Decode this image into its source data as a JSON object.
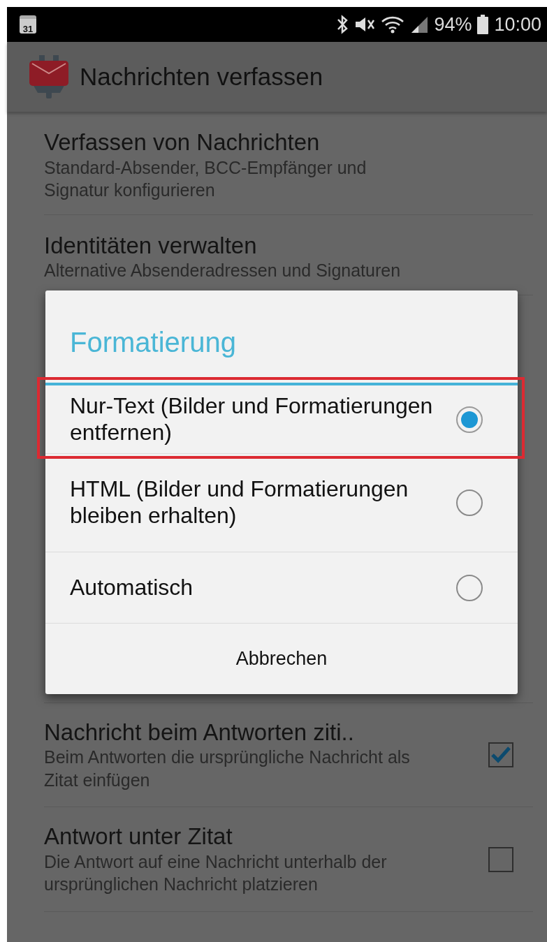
{
  "status_bar": {
    "calendar_day": "31",
    "battery": "94%",
    "time": "10:00"
  },
  "app_bar": {
    "title": "Nachrichten verfassen"
  },
  "settings": [
    {
      "kind": "text",
      "title": "Verfassen von Nachrichten",
      "summary": "Standard-Absender, BCC-Empfänger und Signatur konfigurieren"
    },
    {
      "kind": "text",
      "title": "Identitäten verwalten",
      "summary": "Alternative Absenderadressen und Signaturen"
    },
    {
      "kind": "hidden"
    },
    {
      "kind": "checkbox",
      "title": "Nachricht beim Antworten ziti..",
      "summary": "Beim Antworten die ursprüngliche Nachricht als Zitat einfügen",
      "checked": true
    },
    {
      "kind": "checkbox",
      "title": "Antwort unter Zitat",
      "summary": "Die Antwort auf eine Nachricht unterhalb der ursprünglichen Nachricht platzieren",
      "checked": false
    }
  ],
  "dialog": {
    "title": "Formatierung",
    "options": [
      {
        "label": "Nur-Text (Bilder und Formatierungen entfernen)",
        "selected": true,
        "highlighted": true
      },
      {
        "label": "HTML (Bilder und Formatierungen bleiben erhalten)",
        "selected": false,
        "highlighted": false
      },
      {
        "label": "Automatisch",
        "selected": false,
        "highlighted": false
      }
    ],
    "cancel": "Abbrechen"
  }
}
